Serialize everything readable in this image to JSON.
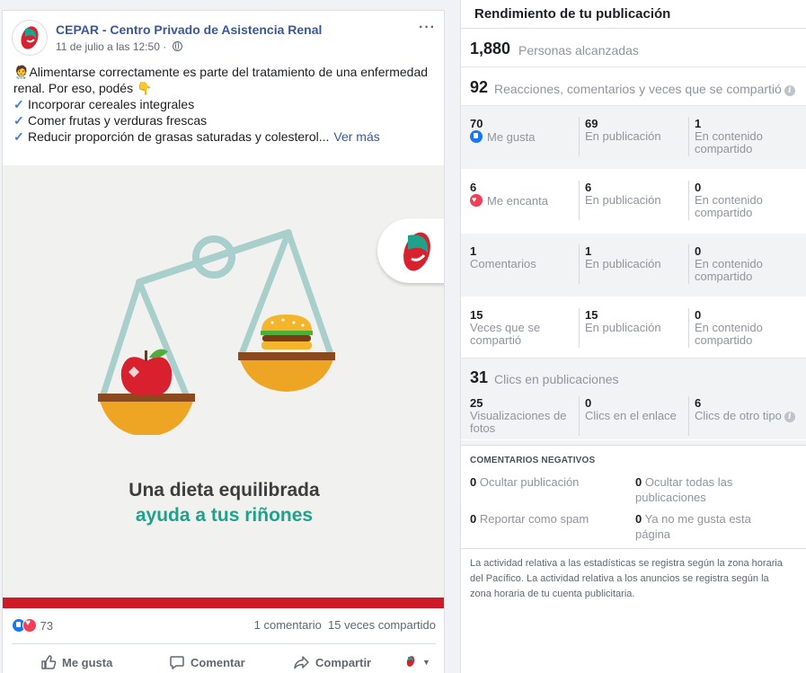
{
  "post": {
    "page_name": "CEPAR - Centro Privado de Asistencia Renal",
    "timestamp": "11 de julio a las 12:50 · ",
    "more_icon": "···",
    "text_intro": "Alimentarse correctamente es parte del tratamiento de una enfermedad renal. Por eso, podés",
    "list": [
      "Incorporar cereales integrales",
      "Comer frutas y verduras frescas",
      "Reducir proporción de grasas saturadas y colesterol..."
    ],
    "see_more": "Ver más",
    "image": {
      "tagline_line1": "Una dieta equilibrada",
      "tagline_line2": "ayuda a tus riñones"
    },
    "reaction_count": "73",
    "comments_count": "1 comentario",
    "shares_count": "15 veces compartido",
    "actions": {
      "like": "Me gusta",
      "comment": "Comentar",
      "share": "Compartir"
    }
  },
  "insights": {
    "title": "Rendimiento de tu publicación",
    "reach": {
      "value": "1,880",
      "label": "Personas alcanzadas"
    },
    "engagement": {
      "value": "92",
      "label": "Reacciones, comentarios y veces que se compartió"
    },
    "breakdown": [
      {
        "value": "70",
        "label": "Me gusta",
        "icon": "like-icon",
        "in_post_value": "69",
        "in_post_label": "En publicación",
        "shared_value": "1",
        "shared_label": "En contenido compartido"
      },
      {
        "value": "6",
        "label": "Me encanta",
        "icon": "love-icon",
        "in_post_value": "6",
        "in_post_label": "En publicación",
        "shared_value": "0",
        "shared_label": "En contenido compartido"
      },
      {
        "value": "1",
        "label": "Comentarios",
        "in_post_value": "1",
        "in_post_label": "En publicación",
        "shared_value": "0",
        "shared_label": "En contenido compartido"
      },
      {
        "value": "15",
        "label": "Veces que se compartió",
        "in_post_value": "15",
        "in_post_label": "En publicación",
        "shared_value": "0",
        "shared_label": "En contenido compartido"
      }
    ],
    "clicks": {
      "value": "31",
      "label": "Clics en publicaciones",
      "photo_views_value": "25",
      "photo_views_label": "Visualizaciones de fotos",
      "link_clicks_value": "0",
      "link_clicks_label": "Clics en el enlace",
      "other_clicks_value": "6",
      "other_clicks_label": "Clics de otro tipo"
    },
    "negative": {
      "title": "COMENTARIOS NEGATIVOS",
      "hide_post_value": "0",
      "hide_post_label": "Ocultar publicación",
      "hide_all_value": "0",
      "hide_all_label": "Ocultar todas las publicaciones",
      "spam_value": "0",
      "spam_label": "Reportar como spam",
      "unlike_value": "0",
      "unlike_label": "Ya no me gusta esta página"
    },
    "footnote": "La actividad relativa a las estadísticas se registra según la zona horaria del Pacífico. La actividad relativa a los anuncios se registra según la zona horaria de tu cuenta publicitaria."
  },
  "colors": {
    "link": "#385898",
    "brand_green": "#1ea28c",
    "brand_red": "#cc1a27",
    "like_blue": "#1877f2",
    "love_red": "#f33e58"
  }
}
